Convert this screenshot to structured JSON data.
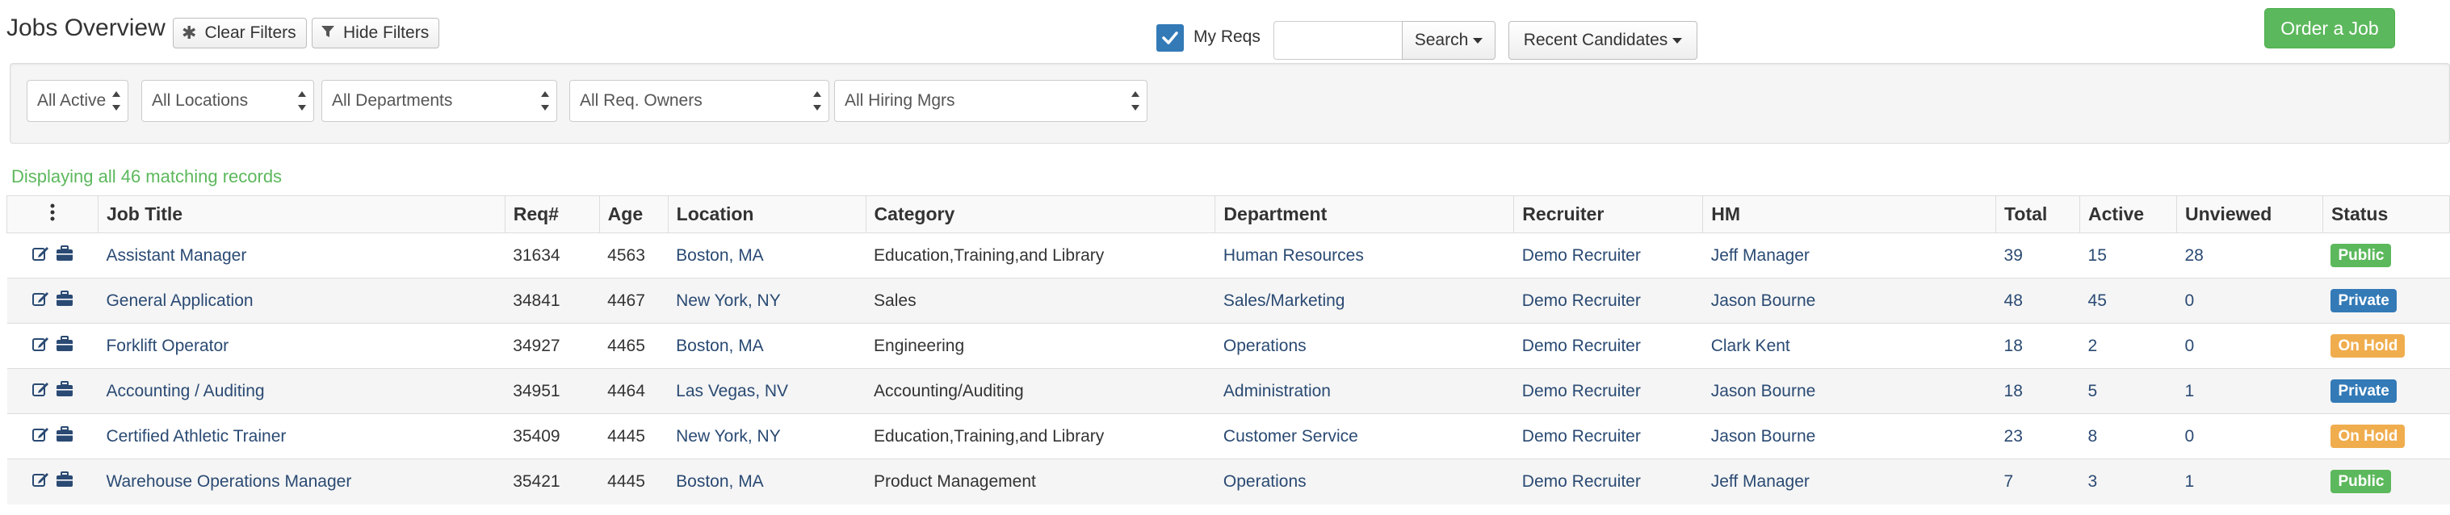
{
  "header": {
    "title": "Jobs Overview",
    "clear_filters": "Clear Filters",
    "hide_filters": "Hide Filters",
    "order_job": "Order a Job"
  },
  "filters": {
    "active": "All Active",
    "locations": "All Locations",
    "departments": "All Departments",
    "req_owners": "All Req. Owners",
    "hiring_mgrs": "All Hiring Mgrs",
    "my_reqs_label": "My Reqs",
    "my_reqs_checked": true,
    "search_value": "",
    "search_button": "Search",
    "recent_candidates": "Recent Candidates"
  },
  "record_count": "Displaying all 46 matching records",
  "table": {
    "columns": [
      "Job Title",
      "Req#",
      "Age",
      "Location",
      "Category",
      "Department",
      "Recruiter",
      "HM",
      "Total",
      "Active",
      "Unviewed",
      "Status"
    ],
    "rows": [
      {
        "title": "Assistant Manager",
        "req": "31634",
        "age": "4563",
        "location": "Boston, MA",
        "category": "Education,Training,and Library",
        "department": "Human Resources",
        "recruiter": "Demo Recruiter",
        "hm": "Jeff Manager",
        "total": "39",
        "active": "15",
        "unviewed": "28",
        "status": "Public"
      },
      {
        "title": "General Application",
        "req": "34841",
        "age": "4467",
        "location": "New York, NY",
        "category": "Sales",
        "department": "Sales/Marketing",
        "recruiter": "Demo Recruiter",
        "hm": "Jason Bourne",
        "total": "48",
        "active": "45",
        "unviewed": "0",
        "status": "Private"
      },
      {
        "title": "Forklift Operator",
        "req": "34927",
        "age": "4465",
        "location": "Boston, MA",
        "category": "Engineering",
        "department": "Operations",
        "recruiter": "Demo Recruiter",
        "hm": "Clark Kent",
        "total": "18",
        "active": "2",
        "unviewed": "0",
        "status": "On Hold"
      },
      {
        "title": "Accounting / Auditing",
        "req": "34951",
        "age": "4464",
        "location": "Las Vegas, NV",
        "category": "Accounting/Auditing",
        "department": "Administration",
        "recruiter": "Demo Recruiter",
        "hm": "Jason Bourne",
        "total": "18",
        "active": "5",
        "unviewed": "1",
        "status": "Private"
      },
      {
        "title": "Certified Athletic Trainer",
        "req": "35409",
        "age": "4445",
        "location": "New York, NY",
        "category": "Education,Training,and Library",
        "department": "Customer Service",
        "recruiter": "Demo Recruiter",
        "hm": "Jason Bourne",
        "total": "23",
        "active": "8",
        "unviewed": "0",
        "status": "On Hold"
      },
      {
        "title": "Warehouse Operations Manager",
        "req": "35421",
        "age": "4445",
        "location": "Boston, MA",
        "category": "Product Management",
        "department": "Operations",
        "recruiter": "Demo Recruiter",
        "hm": "Jeff Manager",
        "total": "7",
        "active": "3",
        "unviewed": "1",
        "status": "Public"
      }
    ]
  },
  "status_colors": {
    "Public": "#5cb85c",
    "Private": "#337ab7",
    "On Hold": "#f0ad4e"
  },
  "icons": {
    "row_edit": "edit-icon",
    "row_briefcase": "briefcase-icon",
    "menu": "vertical-ellipsis-icon"
  }
}
